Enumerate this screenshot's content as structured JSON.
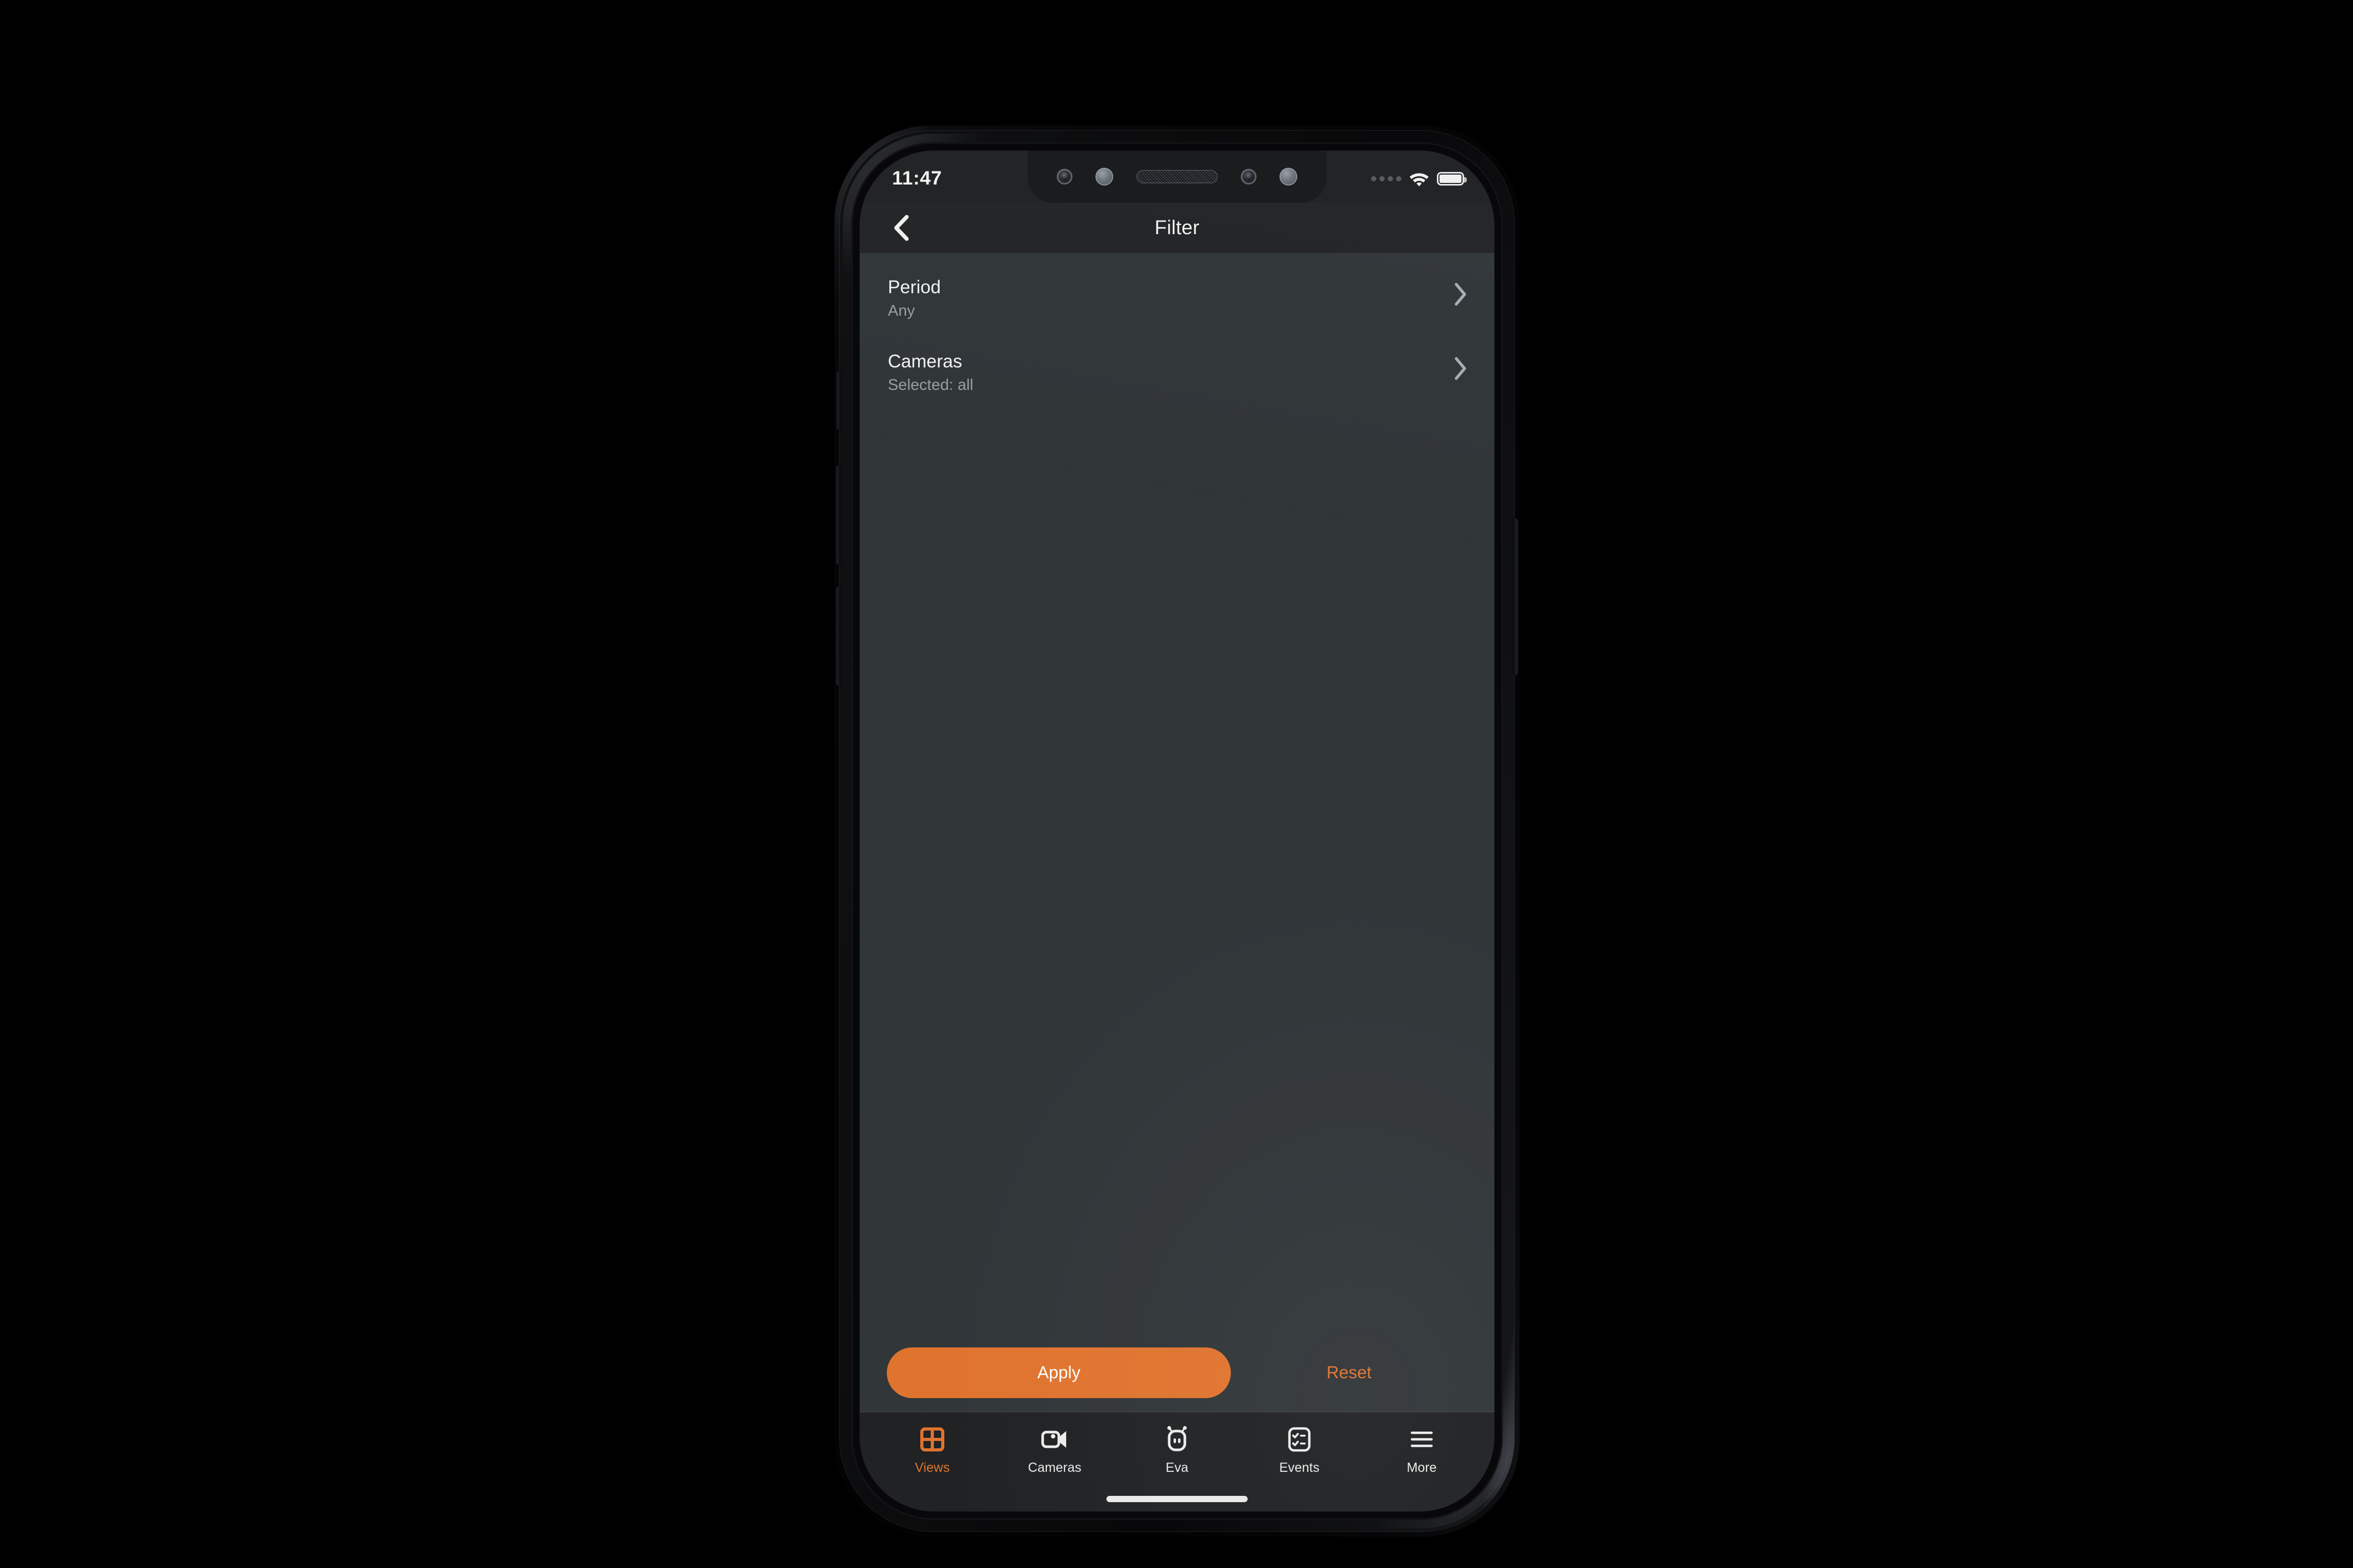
{
  "device": {
    "statusbar": {
      "time": "11:47",
      "signal_icon": "signal-dots-icon",
      "wifi_icon": "wifi-icon",
      "battery_icon": "battery-full-icon"
    },
    "home_indicator": "home-indicator"
  },
  "header": {
    "back_icon": "chevron-left-icon",
    "title": "Filter"
  },
  "filters": [
    {
      "id": "period",
      "title": "Period",
      "value": "Any",
      "chevron_icon": "chevron-right-icon"
    },
    {
      "id": "cameras",
      "title": "Cameras",
      "value": "Selected: all",
      "chevron_icon": "chevron-right-icon"
    }
  ],
  "actions": {
    "apply_label": "Apply",
    "reset_label": "Reset"
  },
  "tabbar": {
    "items": [
      {
        "label": "Views",
        "icon": "grid-views-icon",
        "active": true
      },
      {
        "label": "Cameras",
        "icon": "video-camera-icon",
        "active": false
      },
      {
        "label": "Eva",
        "icon": "robot-head-icon",
        "active": false
      },
      {
        "label": "Events",
        "icon": "checklist-icon",
        "active": false
      },
      {
        "label": "More",
        "icon": "hamburger-menu-icon",
        "active": false
      }
    ]
  },
  "colors": {
    "accent": "#e0742f",
    "screen_bg": "#313639",
    "bar_bg": "#222426",
    "tabbar_bg": "#202224",
    "text_primary": "#f1f2f2",
    "text_secondary": "#9a9ea1",
    "page_bg": "#000000"
  }
}
